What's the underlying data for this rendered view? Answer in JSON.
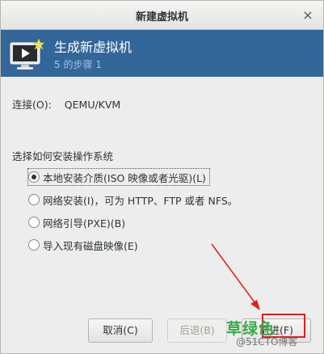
{
  "window": {
    "title": "新建虚拟机",
    "close_glyph": "×"
  },
  "banner": {
    "title": "生成新虚拟机",
    "step": "5 的步骤 1",
    "icon": "monitor-icon"
  },
  "connection": {
    "label": "连接(O):",
    "value": "QEMU/KVM"
  },
  "install": {
    "title": "选择如何安装操作系统",
    "options": [
      {
        "label": "本地安装介质(ISO 映像或者光驱)(L)",
        "selected": true
      },
      {
        "label": "网络安装(I)，可为 HTTP、FTP 或者 NFS。",
        "selected": false
      },
      {
        "label": "网络引导(PXE)(B)",
        "selected": false
      },
      {
        "label": "导入现有磁盘映像(E)",
        "selected": false
      }
    ]
  },
  "buttons": {
    "cancel": "取消(C)",
    "back": "后退(B)",
    "forward": "前进(F)"
  },
  "annotation": {
    "stamp": "草绿色",
    "watermark": "@51CTO博客",
    "accent_color": "#e02020"
  },
  "colors": {
    "banner_bg": "#336699",
    "banner_step": "#9fc1e3"
  }
}
